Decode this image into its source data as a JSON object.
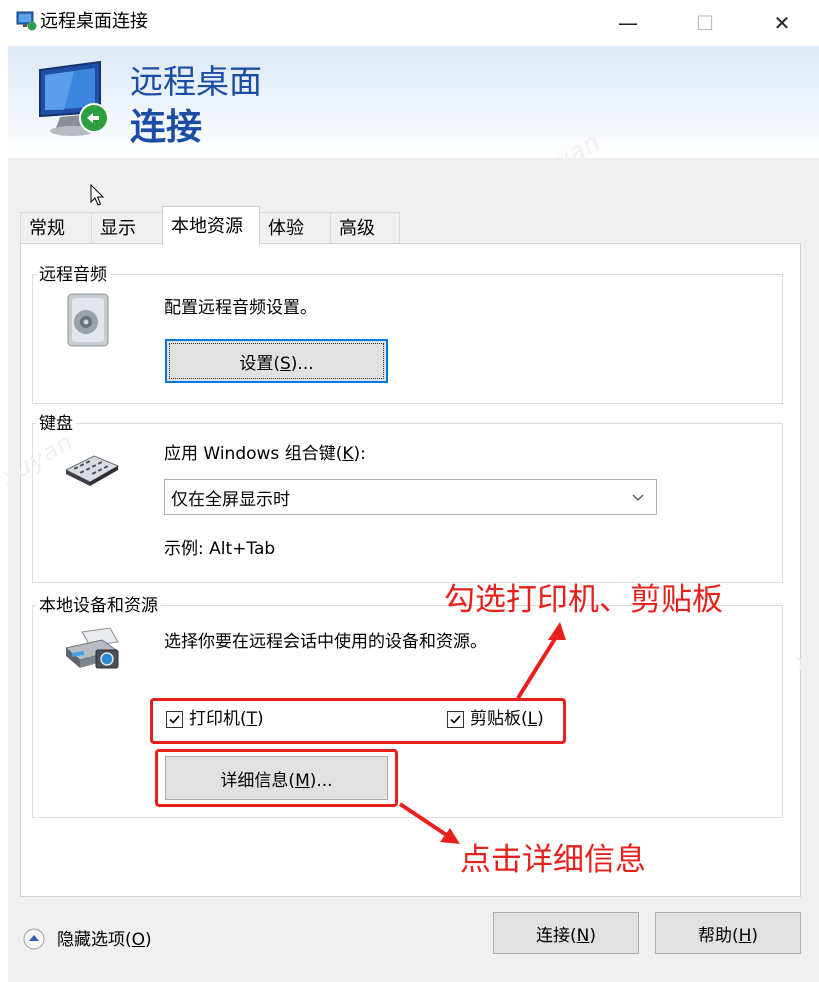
{
  "window": {
    "title": "远程桌面连接",
    "minimize_glyph": "—",
    "maximize_glyph": "☐",
    "close_glyph": "✕"
  },
  "banner": {
    "line1": "远程桌面",
    "line2": "连接"
  },
  "tabs": [
    {
      "label": "常规",
      "active": false
    },
    {
      "label": "显示",
      "active": false
    },
    {
      "label": "本地资源",
      "active": true
    },
    {
      "label": "体验",
      "active": false
    },
    {
      "label": "高级",
      "active": false
    }
  ],
  "remote_audio": {
    "group_label": "远程音频",
    "description": "配置远程音频设置。",
    "settings_button_pre": "设置(",
    "settings_button_key": "S",
    "settings_button_post": ")..."
  },
  "keyboard": {
    "group_label": "键盘",
    "apply_label_pre": "应用 Windows 组合键(",
    "apply_label_key": "K",
    "apply_label_post": "):",
    "selected_option": "仅在全屏显示时",
    "example": "示例: Alt+Tab"
  },
  "local_devices": {
    "group_label": "本地设备和资源",
    "description": "选择你要在远程会话中使用的设备和资源。",
    "printer": {
      "pre": "打印机(",
      "key": "T",
      "post": ")",
      "checked": true
    },
    "clipboard": {
      "pre": "剪贴板(",
      "key": "L",
      "post": ")",
      "checked": true
    },
    "details_button_pre": "详细信息(",
    "details_button_key": "M",
    "details_button_post": ")..."
  },
  "annotations": {
    "select_hint": "勾选打印机、剪贴板",
    "click_hint": "点击详细信息",
    "color": "#e8201c"
  },
  "watermark": "xuyan",
  "footer": {
    "hide_options_pre": "隐藏选项(",
    "hide_options_key": "O",
    "hide_options_post": ")",
    "connect_pre": "连接(",
    "connect_key": "N",
    "connect_post": ")",
    "help_pre": "帮助(",
    "help_key": "H",
    "help_post": ")"
  },
  "colors": {
    "banner_text": "#1c4da5",
    "focus": "#0078d7",
    "body_bg": "#f0f0f0"
  }
}
